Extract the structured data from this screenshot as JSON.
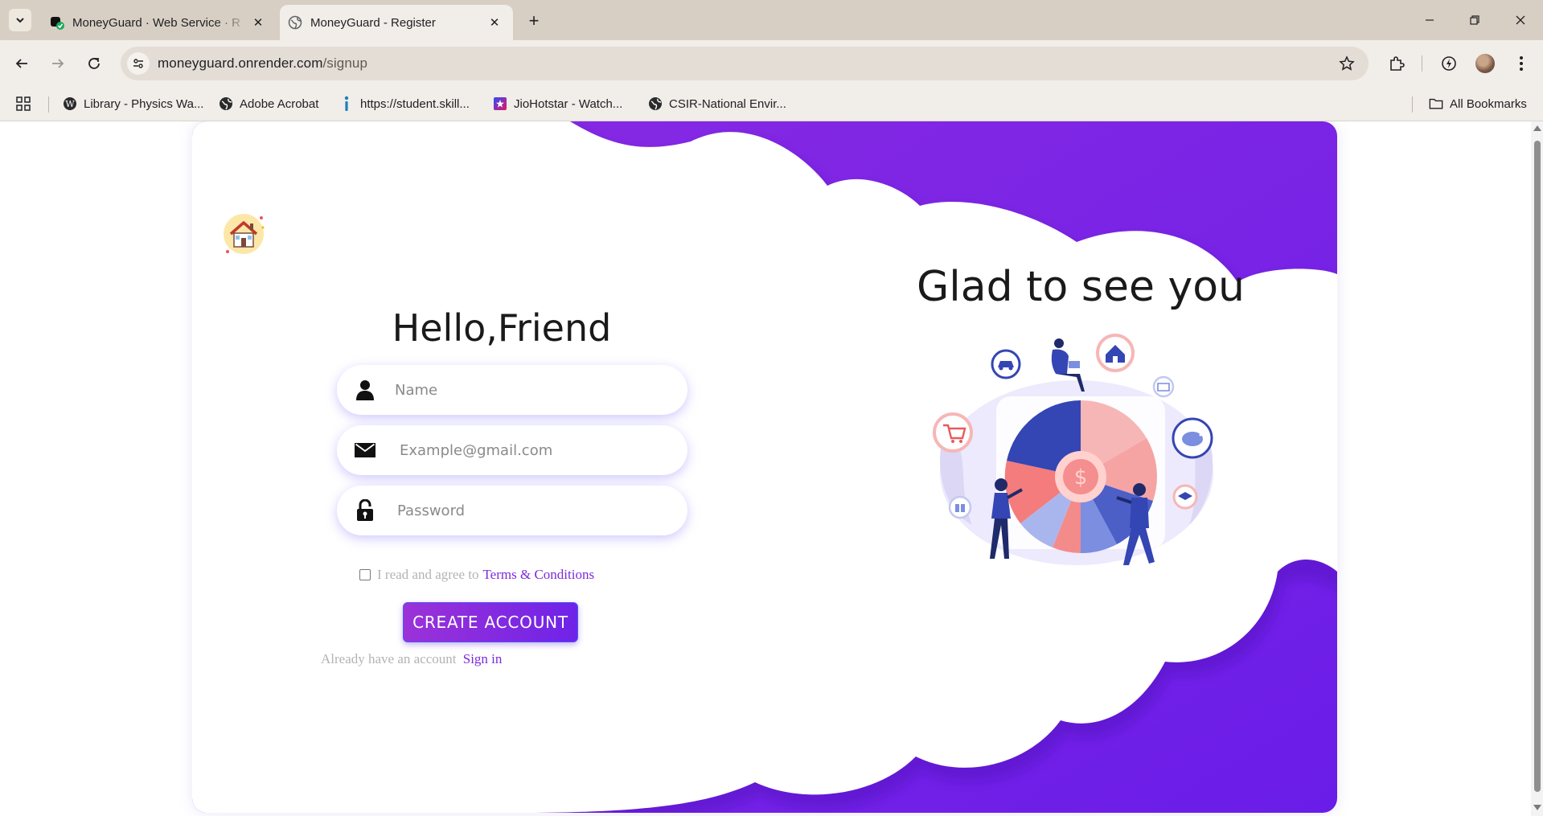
{
  "browser": {
    "tabs": [
      {
        "title": "MoneyGuard · Web Service · R",
        "active": false
      },
      {
        "title": "MoneyGuard - Register",
        "active": true
      }
    ],
    "url_host": "moneyguard.onrender.com",
    "url_path": "/signup",
    "bookmarks": [
      {
        "label": "Library - Physics Wa...",
        "icon": "wordpress-icon"
      },
      {
        "label": "Adobe Acrobat",
        "icon": "globe-icon"
      },
      {
        "label": "https://student.skill...",
        "icon": "info-icon"
      },
      {
        "label": "JioHotstar - Watch...",
        "icon": "hotstar-icon"
      },
      {
        "label": "CSIR-National Envir...",
        "icon": "globe-icon"
      }
    ],
    "all_bookmarks_label": "All Bookmarks"
  },
  "form": {
    "title": "Hello,Friend",
    "name_placeholder": "Name",
    "email_placeholder": "Example@gmail.com",
    "password_placeholder": "Password",
    "terms_prefix": "I read and agree to",
    "terms_link": "Terms & Conditions",
    "create_button": "CREATE ACCOUNT",
    "signin_prefix": "Already have an account",
    "signin_link": "Sign in"
  },
  "welcome": {
    "heading": "Glad to see you"
  },
  "colors": {
    "accent_purple": "#7b2cd8",
    "background_purple": "#7a24e6",
    "button_gradient_start": "#9b32d8",
    "button_gradient_end": "#6f23e8"
  }
}
